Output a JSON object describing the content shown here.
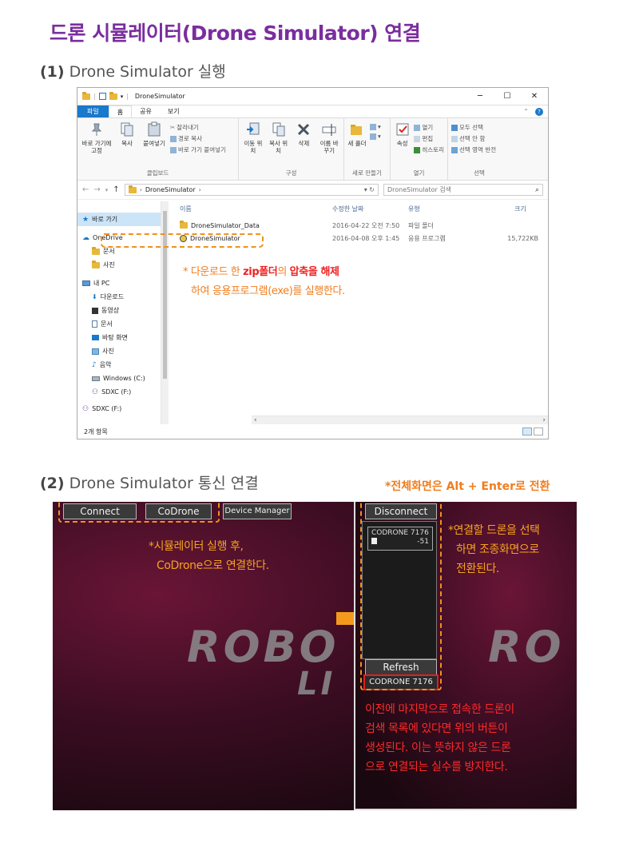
{
  "title": "드론 시뮬레이터(Drone Simulator) 연결",
  "section1": {
    "num": "(1)",
    "text": "Drone Simulator 실행"
  },
  "section2": {
    "num": "(2)",
    "text": "Drone Simulator 통신 연결"
  },
  "explorer": {
    "window_title": "DroneSimulator",
    "winctl": {
      "minimize": "─",
      "maximize": "☐",
      "close": "✕"
    },
    "tabs": [
      "파일",
      "홈",
      "공유",
      "보기"
    ],
    "ribbon": {
      "clipboard": {
        "pin": "바로 가기에 고정",
        "copy": "복사",
        "paste": "붙여넣기",
        "cut": "잘라내기",
        "copy_path": "경로 복사",
        "paste_shortcut": "바로 가기 붙여넣기",
        "label": "클립보드"
      },
      "organize": {
        "move": "이동 위치",
        "copy_to": "복사 위치",
        "delete": "삭제",
        "rename": "이름 바꾸기",
        "label": "구성"
      },
      "new": {
        "new_folder": "새 폴더",
        "label": "새로 만들기"
      },
      "open": {
        "properties": "속성",
        "open": "열기",
        "edit": "편집",
        "history": "히스토리",
        "label": "열기"
      },
      "select": {
        "select_all": "모두 선택",
        "select_none": "선택 안 함",
        "invert": "선택 영역 반전",
        "label": "선택"
      }
    },
    "address": "DroneSimulator",
    "search_placeholder": "DroneSimulator 검색",
    "nav": {
      "quick": "바로 가기",
      "onedrive": "OneDrive",
      "od_docs": "문서",
      "od_pics": "사진",
      "pc": "내 PC",
      "downloads": "다운로드",
      "videos": "동영상",
      "documents": "문서",
      "desktop": "바탕 화면",
      "pictures": "사진",
      "music": "음악",
      "windows": "Windows (C:)",
      "sdxc1": "SDXC (F:)",
      "sdxc2": "SDXC (F:)"
    },
    "columns": {
      "name": "이름",
      "date": "수정한 날짜",
      "type": "유형",
      "size": "크기"
    },
    "files": [
      {
        "name": "DroneSimulator_Data",
        "date": "2016-04-22 오전 7:50",
        "type": "파일 폴더",
        "size": ""
      },
      {
        "name": "DroneSimulator",
        "date": "2016-04-08 오후 1:45",
        "type": "응용 프로그램",
        "size": "15,722KB"
      }
    ],
    "status": "2개 항목"
  },
  "note1": {
    "p1": "* 다운로드 한 ",
    "em1": "zip폴더",
    "p2": "의 ",
    "em2": "압축을 해제",
    "line2": "하여 응용프로그램(exe)를 실행한다."
  },
  "fullscreen_note": "*전체화면은 Alt + Enter로 전환",
  "sim_left": {
    "connect": "Connect",
    "codrone": "CoDrone",
    "device_manager": "Device Manager",
    "note_l1": "*시뮬레이터 실행 후,",
    "note_l2": "CoDrone으로 연결한다.",
    "robo1": "ROBO",
    "robo2": "LI"
  },
  "sim_right": {
    "disconnect": "Disconnect",
    "entry_name": "CODRONE 7176",
    "entry_rssi": "-51",
    "refresh": "Refresh",
    "last": "CODRONE 7176",
    "note_l1": "*연결할 드론을 선택",
    "note_l2": "하면 조종화면으로",
    "note_l3": "전환된다.",
    "red1": "이전에 마지막으로 접속한 드론이",
    "red2": "검색 목록에 있다면 위의 버튼이",
    "red3": "생성된다. 이는 뜻하지 않은 드론",
    "red4": "으로 연결되는 실수를 방지한다.",
    "robo": "RO"
  },
  "colors": {
    "title": "#7a2e9e",
    "accent_orange": "#f07d1e",
    "alert_red": "#e22222",
    "file_tab": "#1979ca"
  }
}
